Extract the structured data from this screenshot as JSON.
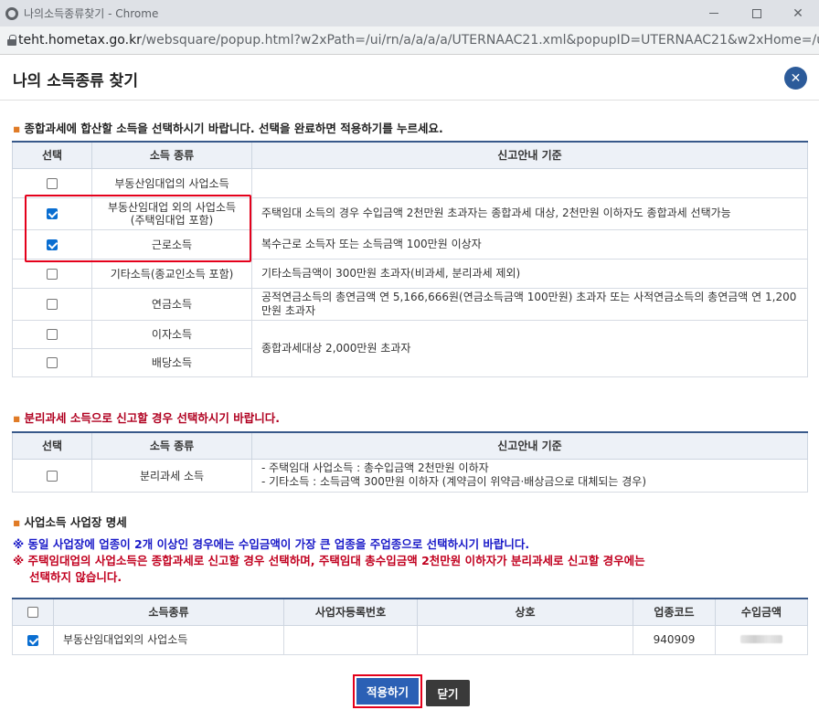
{
  "window": {
    "title": "나의소득종류찾기 - Chrome",
    "url_host": "teht.hometax.go.kr",
    "url_path": "/websquare/popup.html?w2xPath=/ui/rn/a/a/a/a/UTERNAAC21.xml&popupID=UTERNAAC21&w2xHome=/ui/rn/z..."
  },
  "popup": {
    "title": "나의 소득종류 찾기",
    "close_symbol": "✕"
  },
  "section1": {
    "title": "종합과세에 합산할 소득을 선택하시기 바랍니다. 선택을 완료하면 적용하기를 누르세요.",
    "headers": [
      "선택",
      "소득 종류",
      "신고안내 기준"
    ],
    "rows": [
      {
        "income": "부동산임대업의 사업소득",
        "checked": false,
        "guide": ""
      },
      {
        "income": "부동산임대업 외의 사업소득",
        "income2": "(주택임대업 포함)",
        "checked": true,
        "guide": "주택임대 소득의 경우 수입금액 2천만원 초과자는 종합과세 대상, 2천만원 이하자도 종합과세 선택가능"
      },
      {
        "income": "근로소득",
        "checked": true,
        "guide": "복수근로 소득자 또는 소득금액 100만원 이상자"
      },
      {
        "income": "기타소득(종교인소득 포함)",
        "checked": false,
        "guide": "기타소득금액이 300만원 초과자(비과세, 분리과세 제외)"
      },
      {
        "income": "연금소득",
        "checked": false,
        "guide": "공적연금소득의 총연금액 연 5,166,666원(연금소득금액 100만원) 초과자 또는 사적연금소득의 총연금액 연 1,200만원 초과자"
      },
      {
        "income": "이자소득",
        "checked": false
      },
      {
        "income": "배당소득",
        "checked": false
      }
    ],
    "merged_guide": "종합과세대상 2,000만원 초과자"
  },
  "section2": {
    "title": "분리과세 소득으로 신고할 경우 선택하시기 바랍니다.",
    "headers": [
      "선택",
      "소득 종류",
      "신고안내 기준"
    ],
    "row": {
      "income": "분리과세 소득",
      "checked": false,
      "guide1": "- 주택임대 사업소득 : 총수입금액 2천만원 이하자",
      "guide2": "- 기타소득 : 소득금액 300만원 이하자 (계약금이 위약금·배상금으로 대체되는 경우)"
    }
  },
  "section3": {
    "title": "사업소득 사업장 명세",
    "note1": "※ 동일 사업장에 업종이 2개 이상인 경우에는 수입금액이 가장 큰 업종을 주업종으로 선택하시기 바랍니다.",
    "note2a": "※ 주택임대업의 사업소득은 종합과세로 신고할 경우 선택하며, 주택임대 총수입금액 2천만원 이하자가 분리과세로 신고할 경우에는",
    "note2b": "선택하지 않습니다.",
    "headers": [
      "소득종류",
      "사업자등록번호",
      "상호",
      "업종코드",
      "수입금액"
    ],
    "row": {
      "checked": true,
      "income": "부동산임대업외의 사업소득",
      "bizno": "",
      "name": "",
      "code": "940909"
    }
  },
  "buttons": {
    "apply": "적용하기",
    "close": "닫기"
  },
  "colors": {
    "accent": "#2b60b5",
    "highlight": "#e4001b",
    "note_blue": "#1a1ac8",
    "note_red": "#c1001f",
    "table_top_border": "#38598a"
  }
}
